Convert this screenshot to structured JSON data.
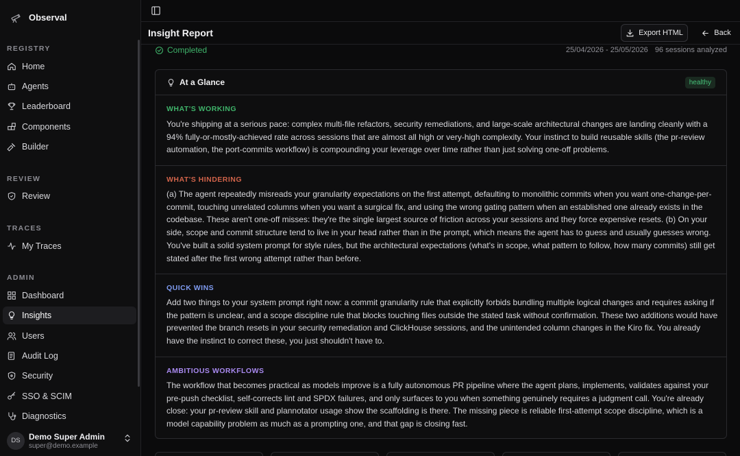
{
  "brand": {
    "name": "Observal"
  },
  "sidebar": {
    "sections": [
      {
        "label": "REGISTRY",
        "items": [
          "Home",
          "Agents",
          "Leaderboard",
          "Components",
          "Builder"
        ]
      },
      {
        "label": "REVIEW",
        "items": [
          "Review"
        ]
      },
      {
        "label": "TRACES",
        "items": [
          "My Traces"
        ]
      },
      {
        "label": "ADMIN",
        "items": [
          "Dashboard",
          "Insights",
          "Users",
          "Audit Log",
          "Security",
          "SSO & SCIM",
          "Diagnostics"
        ]
      }
    ],
    "active_item": "Insights"
  },
  "user": {
    "initials": "DS",
    "name": "Demo Super Admin",
    "email": "super@demo.example"
  },
  "header": {
    "title": "Insight Report",
    "export_label": "Export HTML",
    "back_label": "Back"
  },
  "status": {
    "label": "Completed",
    "date_range": "25/04/2026 - 25/05/2026",
    "sessions": "96 sessions analyzed"
  },
  "colors": {
    "success": "#3fb36a",
    "working": "#3fb36a",
    "hindering": "#d0634a",
    "quick_wins": "#7f9bf0",
    "ambitious": "#a98af0"
  },
  "glance": {
    "title": "At a Glance",
    "badge": "healthy",
    "sections": [
      {
        "label": "WHAT'S WORKING",
        "text": "You're shipping at a serious pace: complex multi-file refactors, security remediations, and large-scale architectural changes are landing cleanly with a 94% fully-or-mostly-achieved rate across sessions that are almost all high or very-high complexity. Your instinct to build reusable skills (the pr-review automation, the port-commits workflow) is compounding your leverage over time rather than just solving one-off problems."
      },
      {
        "label": "WHAT'S HINDERING",
        "text": "(a) The agent repeatedly misreads your granularity expectations on the first attempt, defaulting to monolithic commits when you want one-change-per-commit, touching unrelated columns when you want a surgical fix, and using the wrong gating pattern when an established one already exists in the codebase. These aren't one-off misses: they're the single largest source of friction across your sessions and they force expensive resets. (b) On your side, scope and commit structure tend to live in your head rather than in the prompt, which means the agent has to guess and usually guesses wrong. You've built a solid system prompt for style rules, but the architectural expectations (what's in scope, what pattern to follow, how many commits) still get stated after the first wrong attempt rather than before."
      },
      {
        "label": "QUICK WINS",
        "text": "Add two things to your system prompt right now: a commit granularity rule that explicitly forbids bundling multiple logical changes and requires asking if the pattern is unclear, and a scope discipline rule that blocks touching files outside the stated task without confirmation. These two additions would have prevented the branch resets in your security remediation and ClickHouse sessions, and the unintended column changes in the Kiro fix. You already have the instinct to correct these, you just shouldn't have to."
      },
      {
        "label": "AMBITIOUS WORKFLOWS",
        "text": "The workflow that becomes practical as models improve is a fully autonomous PR pipeline where the agent plans, implements, validates against your pre-push checklist, self-corrects lint and SPDX failures, and only surfaces to you when something genuinely requires a judgment call. You're already close: your pr-review skill and plannotator usage show the scaffolding is there. The missing piece is reliable first-attempt scope discipline, which is a model capability problem as much as a prompting one, and that gap is closing fast."
      }
    ]
  }
}
